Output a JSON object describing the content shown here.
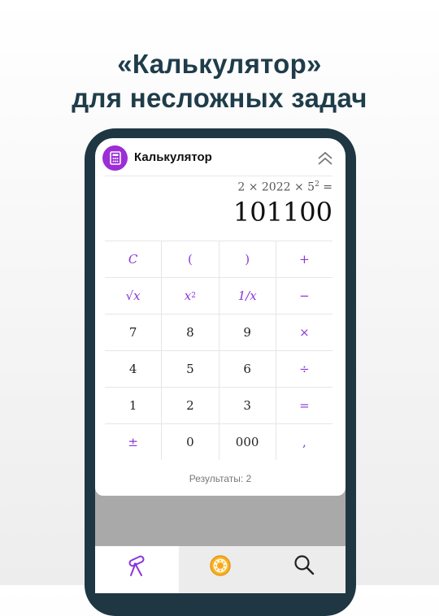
{
  "promo": {
    "line1": "«Калькулятор»",
    "line2": "для несложных задач"
  },
  "app": {
    "title": "Калькулятор",
    "icon": "calculator-icon",
    "accent_color": "#9b2ed6"
  },
  "display": {
    "expression_base": "2 × 2022 × 5",
    "expression_exponent": "2",
    "expression_suffix": " =",
    "result": "101100"
  },
  "keypad": {
    "row1": [
      "C",
      "(",
      ")",
      "+"
    ],
    "row2": {
      "sqrt": "√x",
      "square_base": "x",
      "square_exp": "2",
      "reciprocal": "1/x",
      "minus": "−"
    },
    "row3": [
      "7",
      "8",
      "9",
      "×"
    ],
    "row4": [
      "4",
      "5",
      "6",
      "÷"
    ],
    "row5": [
      "1",
      "2",
      "3",
      "="
    ],
    "row6": [
      "±",
      "0",
      "000",
      ","
    ]
  },
  "results_count": "Результаты: 2",
  "bottom_nav": [
    {
      "icon": "telescope-icon",
      "active": true
    },
    {
      "icon": "sun-icon",
      "active": false
    },
    {
      "icon": "search-icon",
      "active": false
    }
  ]
}
